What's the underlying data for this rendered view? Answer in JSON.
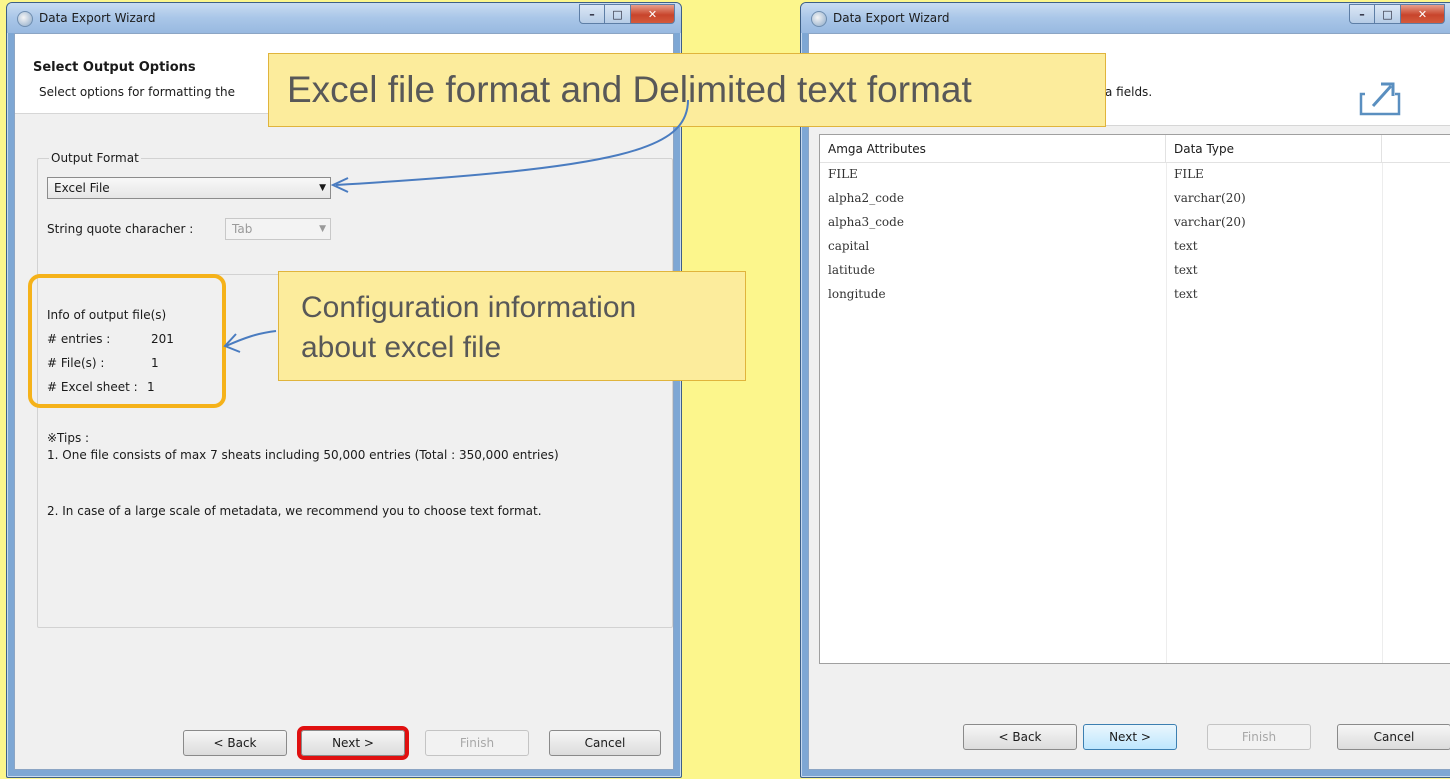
{
  "left_window": {
    "title": "Data Export Wizard",
    "header": {
      "title": "Select Output Options",
      "description": "Select options for formatting the"
    },
    "output_format": {
      "group_label": "Output Format",
      "selected": "Excel File",
      "quote_label": "String quote characher :",
      "quote_value": "Tab"
    },
    "info": {
      "title": "Info of output file(s)",
      "entries_label": "# entries :",
      "entries_value": "201",
      "files_label": "# File(s) :",
      "files_value": "1",
      "sheets_label": "# Excel sheet :",
      "sheets_value": "1"
    },
    "tips": {
      "title": "※Tips :",
      "tip1": "1. One file consists of max 7 sheats including 50,000 entries (Total : 350,000 entries)",
      "tip2": "2. In case of a large scale of metadata, we recommend you to choose text format."
    },
    "buttons": {
      "back": "< Back",
      "next": "Next >",
      "finish": "Finish",
      "cancel": "Cancel"
    }
  },
  "right_window": {
    "title": "Data Export Wizard",
    "header_desc": "a fields.",
    "table": {
      "columns": [
        "Amga Attributes",
        "Data Type"
      ],
      "rows": [
        [
          "FILE",
          "FILE"
        ],
        [
          "alpha2_code",
          "varchar(20)"
        ],
        [
          "alpha3_code",
          "varchar(20)"
        ],
        [
          "capital",
          "text"
        ],
        [
          "latitude",
          "text"
        ],
        [
          "longitude",
          "text"
        ]
      ]
    },
    "buttons": {
      "back": "< Back",
      "next": "Next >",
      "finish": "Finish",
      "cancel": "Cancel"
    }
  },
  "callouts": {
    "format": "Excel file format and Delimited text format",
    "config_line1": "Configuration information",
    "config_line2": "about excel file"
  },
  "colors": {
    "callout_bg": "#fcec9c",
    "highlight_border": "#f5b21a",
    "next_outline": "#e01010",
    "arrow": "#4a7cc0"
  },
  "icons": [
    "app-icon",
    "export-icon",
    "minimize-icon",
    "maximize-icon",
    "close-icon",
    "dropdown-arrow-icon"
  ]
}
